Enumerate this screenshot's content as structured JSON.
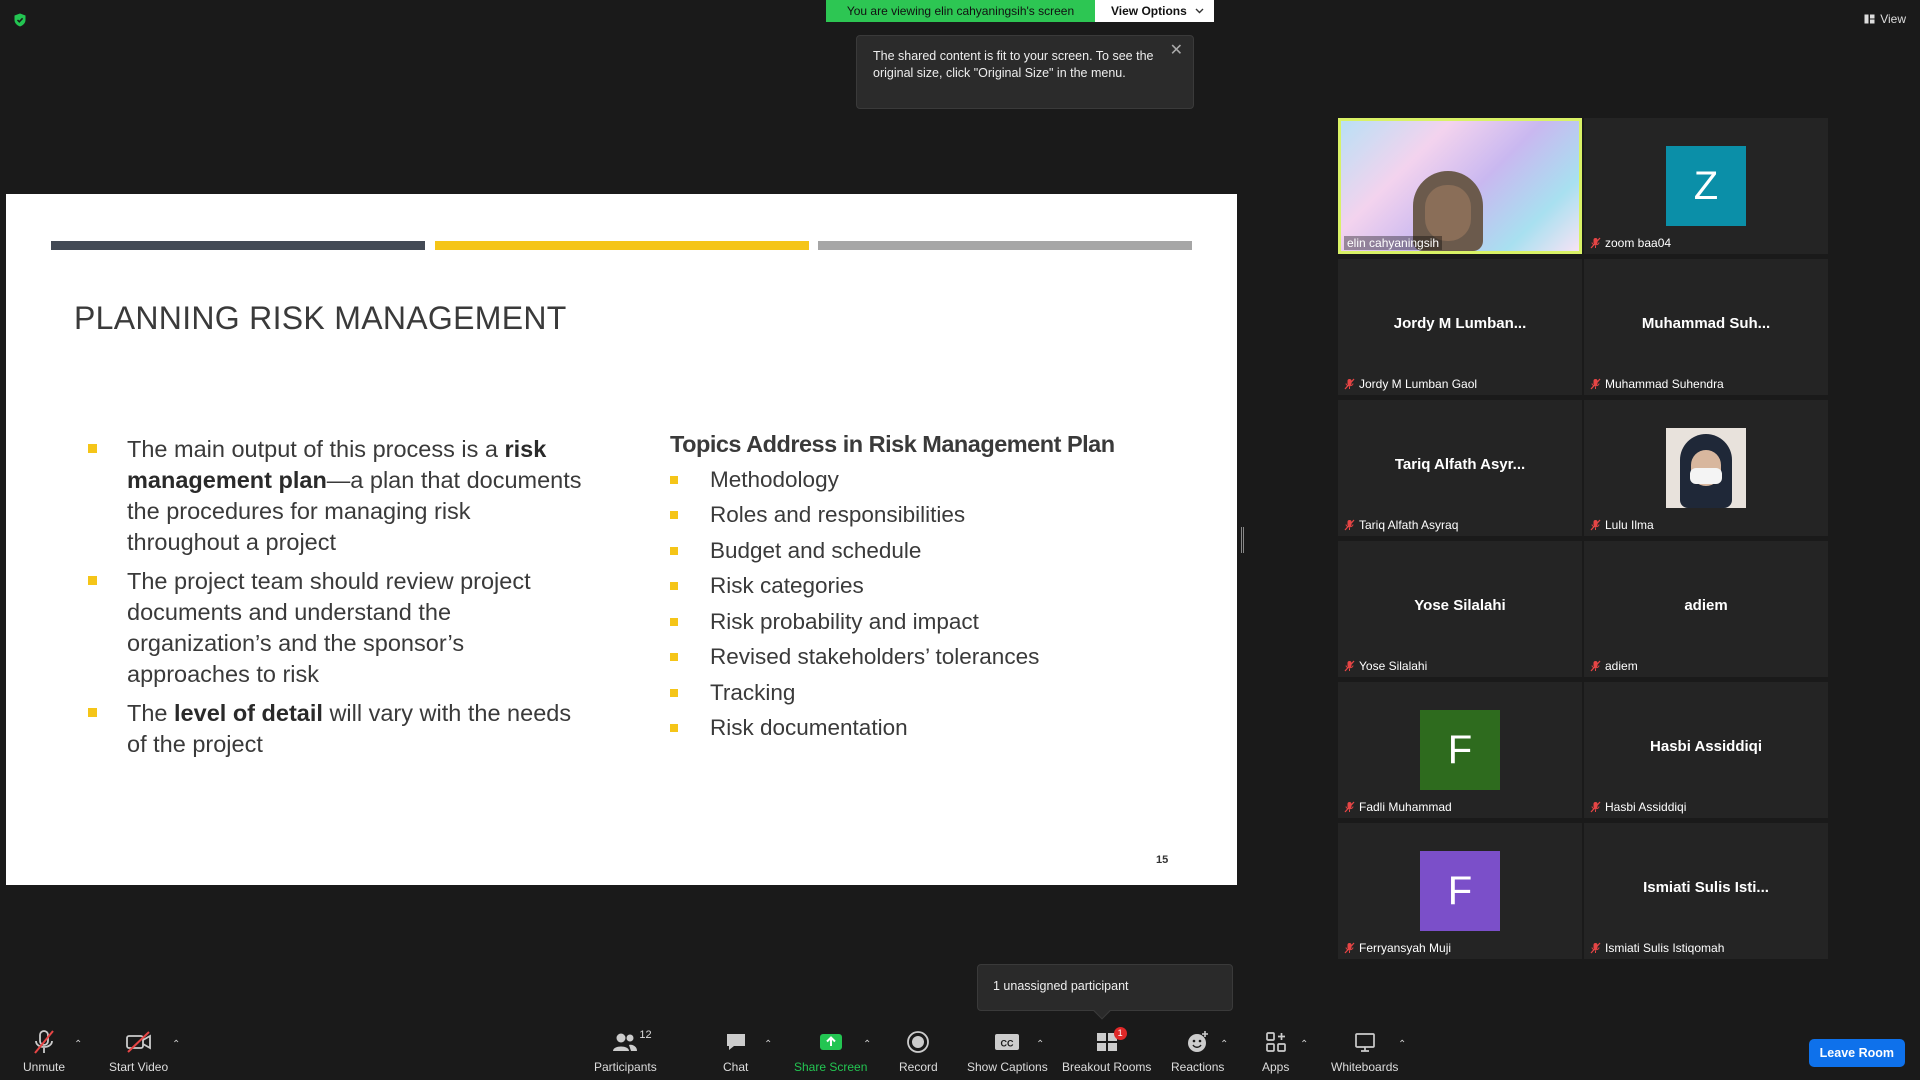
{
  "banner": {
    "viewing_text": "You are viewing elin cahyaningsih's screen",
    "view_options": "View Options"
  },
  "view_button": "View",
  "tooltip": {
    "text": "The shared content is fit to your screen. To see the original size, click \"Original Size\" in the menu."
  },
  "slide": {
    "title": "PLANNING RISK MANAGEMENT",
    "left_bullets": [
      {
        "pre": "The main output of this process is a ",
        "bold": "risk management plan",
        "post": "—a plan that documents the procedures for managing risk throughout a project"
      },
      {
        "pre": "The project team should review project documents and understand the organization’s and the sponsor’s approaches to risk",
        "bold": "",
        "post": ""
      },
      {
        "pre": "The ",
        "bold": "level of detail",
        "post": " will vary with the needs of the project"
      }
    ],
    "right_heading": "Topics Address in Risk Management Plan",
    "right_items": [
      "Methodology",
      "Roles and responsibilities",
      "Budget and schedule",
      "Risk categories",
      "Risk probability and impact",
      "Revised stakeholders’ tolerances",
      "Tracking",
      "Risk documentation"
    ],
    "page_number": "15"
  },
  "participants": [
    {
      "label": "elin cahyaningsih",
      "type": "video",
      "muted": false,
      "active": true
    },
    {
      "label": "zoom baa04",
      "type": "avatar",
      "initial": "Z",
      "color": "#0b8fa8",
      "muted": true
    },
    {
      "label": "Jordy M Lumban Gaol",
      "display": "Jordy M Lumban...",
      "type": "name",
      "muted": true
    },
    {
      "label": "Muhammad Suhendra",
      "display": "Muhammad Suh...",
      "type": "name",
      "muted": true
    },
    {
      "label": "Tariq Alfath Asyraq",
      "display": "Tariq Alfath Asyr...",
      "type": "name",
      "muted": true
    },
    {
      "label": "Lulu Ilma",
      "type": "photo",
      "muted": true
    },
    {
      "label": "Yose Silalahi",
      "display": "Yose Silalahi",
      "type": "name",
      "muted": true
    },
    {
      "label": "adiem",
      "display": "adiem",
      "type": "name",
      "muted": true
    },
    {
      "label": "Fadli Muhammad",
      "type": "avatar",
      "initial": "F",
      "color": "#2e6b1e",
      "muted": true
    },
    {
      "label": "Hasbi Assiddiqi",
      "display": "Hasbi Assiddiqi",
      "type": "name",
      "muted": true
    },
    {
      "label": "Ferryansyah Muji",
      "type": "avatar",
      "initial": "F",
      "color": "#7b4fc9",
      "muted": true
    },
    {
      "label": "Ismiati Sulis Istiqomah",
      "display": "Ismiati Sulis Isti...",
      "type": "name",
      "muted": true
    }
  ],
  "unassigned": "1 unassigned participant",
  "toolbar": {
    "unmute": "Unmute",
    "start_video": "Start Video",
    "participants": "Participants",
    "participants_count": "12",
    "chat": "Chat",
    "share_screen": "Share Screen",
    "record": "Record",
    "show_captions": "Show Captions",
    "breakout_rooms": "Breakout Rooms",
    "breakout_badge": "1",
    "reactions": "Reactions",
    "apps": "Apps",
    "whiteboards": "Whiteboards",
    "leave": "Leave Room"
  },
  "colors": {
    "share_green": "#2dc653",
    "accent_yellow": "#f5c518",
    "leave_blue": "#0e71eb",
    "active_speaker": "#d9f266"
  }
}
